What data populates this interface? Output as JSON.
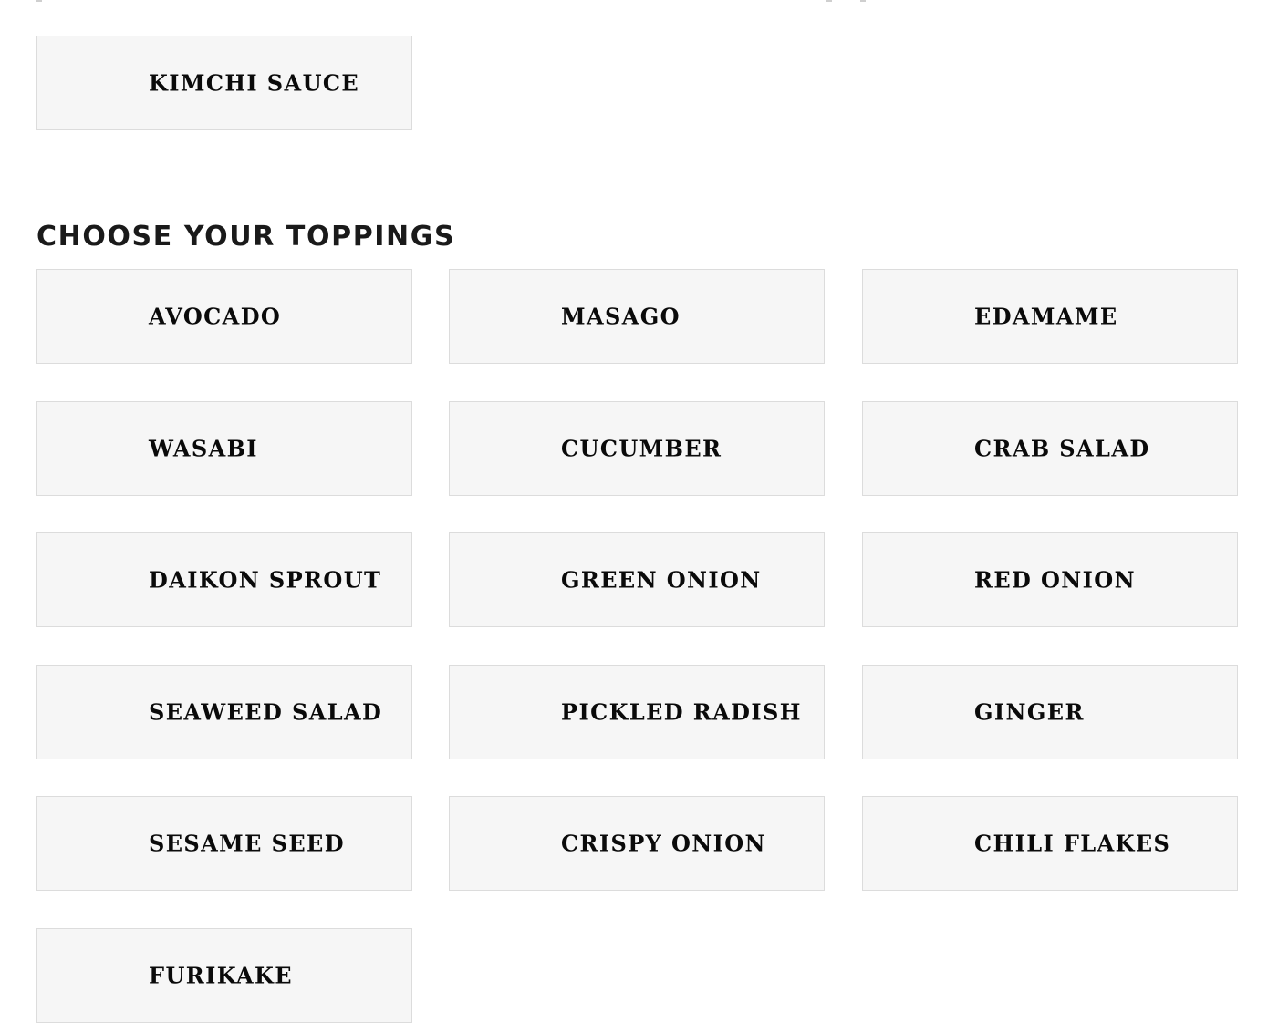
{
  "sauces": {
    "items": [
      {
        "label": "Kimchi Sauce"
      }
    ]
  },
  "toppings": {
    "title": "Choose Your Toppings",
    "items": [
      {
        "label": "Avocado"
      },
      {
        "label": "Masago"
      },
      {
        "label": "Edamame"
      },
      {
        "label": "Wasabi"
      },
      {
        "label": "Cucumber"
      },
      {
        "label": "Crab Salad"
      },
      {
        "label": "Daikon Sprout"
      },
      {
        "label": "Green Onion"
      },
      {
        "label": "Red Onion"
      },
      {
        "label": "Seaweed Salad"
      },
      {
        "label": "Pickled Radish"
      },
      {
        "label": "Ginger"
      },
      {
        "label": "Sesame Seed"
      },
      {
        "label": "Crispy Onion"
      },
      {
        "label": "Chili Flakes"
      },
      {
        "label": "Furikake"
      }
    ]
  },
  "colors": {
    "card_background": "#f6f6f6",
    "card_border": "#dcdcdc",
    "text": "#0a0a0a"
  }
}
